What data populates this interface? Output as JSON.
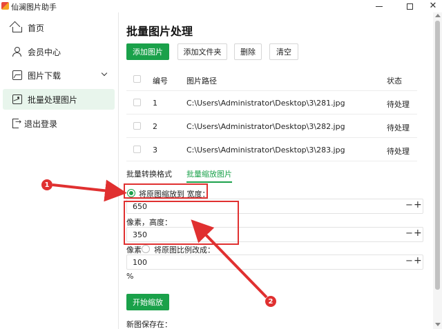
{
  "app": {
    "title": "仙澜图片助手"
  },
  "sidebar": {
    "items": [
      {
        "label": "首页",
        "icon": "home-icon"
      },
      {
        "label": "会员中心",
        "icon": "user-icon"
      },
      {
        "label": "图片下载",
        "icon": "image-icon"
      },
      {
        "label": "批量处理图片",
        "icon": "image-gallery-icon",
        "active": true
      },
      {
        "label": "退出登录",
        "icon": "logout-icon"
      }
    ]
  },
  "main": {
    "title": "批量图片处理",
    "toolbar": {
      "add_image": "添加图片",
      "add_folder": "添加文件夹",
      "delete": "删除",
      "clear": "清空"
    },
    "table": {
      "headers": {
        "no": "编号",
        "path": "图片路径",
        "status": "状态"
      },
      "rows": [
        {
          "no": "1",
          "path": "C:\\Users\\Administrator\\Desktop\\3\\281.jpg",
          "status": "待处理"
        },
        {
          "no": "2",
          "path": "C:\\Users\\Administrator\\Desktop\\3\\282.jpg",
          "status": "待处理"
        },
        {
          "no": "3",
          "path": "C:\\Users\\Administrator\\Desktop\\3\\283.jpg",
          "status": "待处理"
        }
      ]
    },
    "tabs": {
      "format": "批量转换格式",
      "scale": "批量缩放图片"
    },
    "resize": {
      "option1_label": "将原图缩放到 宽度：",
      "width_value": "650",
      "height_label": "像素，高度：",
      "height_value": "350",
      "px_label": "像素",
      "option2_label": "将原图比例改成：",
      "ratio_value": "100",
      "percent": "%",
      "start_button": "开始缩放",
      "save_label": "新图保存在："
    }
  },
  "annotations": {
    "badge1": "1",
    "badge2": "2"
  },
  "colors": {
    "accent": "#1aa14a",
    "annotation": "#e03030"
  }
}
